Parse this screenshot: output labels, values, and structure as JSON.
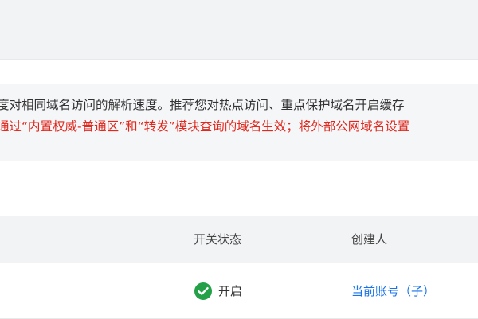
{
  "notice": {
    "line1": "度对相同域名访问的解析速度。推荐您对热点访问、重点保护域名开启缓存",
    "line2": "通过“内置权威-普通区”和“转发”模块查询的域名生效；将外部公网域名设置"
  },
  "table": {
    "columns": {
      "status": "开关状态",
      "creator": "创建人"
    },
    "rows": [
      {
        "status": "开启",
        "status_icon": "check-circle-icon",
        "creator": "当前账号（子）"
      }
    ]
  },
  "colors": {
    "warning_text": "#e0281d",
    "success": "#24a148",
    "link": "#1a73e8"
  }
}
